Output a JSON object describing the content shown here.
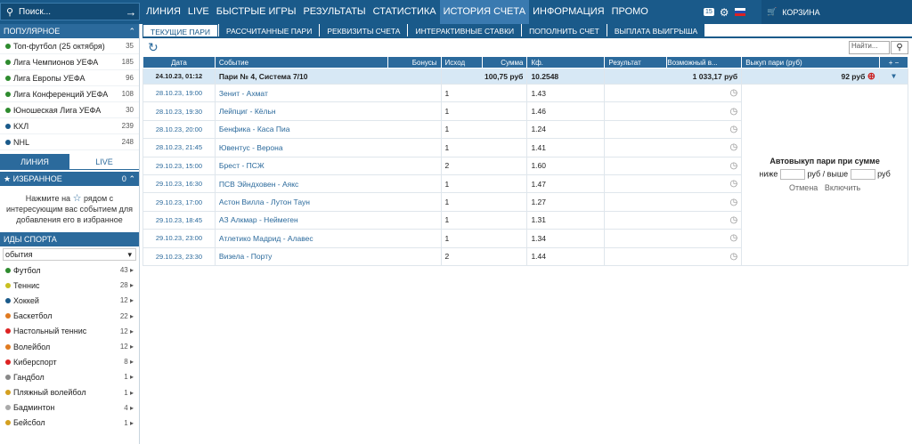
{
  "search": {
    "placeholder": "Поиск..."
  },
  "nav": [
    "ЛИНИЯ",
    "LIVE",
    "БЫСТРЫЕ ИГРЫ",
    "РЕЗУЛЬТАТЫ",
    "СТАТИСТИКА",
    "ИСТОРИЯ СЧЕТА",
    "ИНФОРМАЦИЯ",
    "ПРОМО"
  ],
  "nav_active": "ИСТОРИЯ СЧЕТА",
  "top_badge": "15",
  "cart": "КОРЗИНА",
  "sidebar": {
    "popular_title": "ПОПУЛЯРНОЕ",
    "popular": [
      {
        "label": "Топ-футбол (25 октября)",
        "count": "35"
      },
      {
        "label": "Лига Чемпионов УЕФА",
        "count": "185"
      },
      {
        "label": "Лига Европы УЕФА",
        "count": "96"
      },
      {
        "label": "Лига Конференций УЕФА",
        "count": "108"
      },
      {
        "label": "Юношеская Лига УЕФА",
        "count": "30"
      },
      {
        "label": "КХЛ",
        "count": "239"
      },
      {
        "label": "NHL",
        "count": "248"
      }
    ],
    "tab_line": "ЛИНИЯ",
    "tab_live": "LIVE",
    "fav_title": "ИЗБРАННОЕ",
    "fav_count": "0",
    "fav_text1": "Нажмите на",
    "fav_text2": "рядом с интересующим вас событием для добавления его в избранное",
    "sports_title": "ИДЫ СПОРТА",
    "select_value": "обытия",
    "sports": [
      {
        "label": "Футбол",
        "count": "43",
        "color": "#2e8b2e"
      },
      {
        "label": "Теннис",
        "count": "28",
        "color": "#c9c020"
      },
      {
        "label": "Хоккей",
        "count": "12",
        "color": "#1a5a8a"
      },
      {
        "label": "Баскетбол",
        "count": "22",
        "color": "#e07a20"
      },
      {
        "label": "Настольный теннис",
        "count": "12",
        "color": "#d22"
      },
      {
        "label": "Волейбол",
        "count": "12",
        "color": "#e07a20"
      },
      {
        "label": "Киберспорт",
        "count": "8",
        "color": "#d22"
      },
      {
        "label": "Гандбол",
        "count": "1",
        "color": "#888"
      },
      {
        "label": "Пляжный волейбол",
        "count": "1",
        "color": "#d4a020"
      },
      {
        "label": "Бадминтон",
        "count": "4",
        "color": "#aaa"
      },
      {
        "label": "Бейсбол",
        "count": "1",
        "color": "#d4a020"
      }
    ]
  },
  "tabs": [
    "ТЕКУЩИЕ ПАРИ",
    "РАССЧИТАННЫЕ ПАРИ",
    "РЕКВИЗИТЫ СЧЕТА",
    "ИНТЕРАКТИВНЫЕ СТАВКИ",
    "ПОПОЛНИТЬ СЧЕТ",
    "ВЫПЛАТА ВЫИГРЫША"
  ],
  "find_placeholder": "Найти...",
  "table": {
    "headers": {
      "date": "Дата",
      "event": "Событие",
      "bonus": "Бонусы",
      "outcome": "Исход",
      "sum": "Сумма",
      "coef": "Кф.",
      "result": "Результат",
      "possible": "Возможный в...",
      "buyout": "Выкуп пари (руб)"
    },
    "summary": {
      "date": "24.10.23, 01:12",
      "event": "Пари № 4, Система 7/10",
      "sum": "100,75 руб",
      "coef": "10.2548",
      "possible": "1 033,17 руб",
      "buyout": "92 руб"
    },
    "rows": [
      {
        "date": "28.10.23, 19:00",
        "event": "Зенит - Ахмат",
        "outcome": "1",
        "coef": "1.43"
      },
      {
        "date": "28.10.23, 19:30",
        "event": "Лейпциг - Кёльн",
        "outcome": "1",
        "coef": "1.46"
      },
      {
        "date": "28.10.23, 20:00",
        "event": "Бенфика - Каса Пиа",
        "outcome": "1",
        "coef": "1.24"
      },
      {
        "date": "28.10.23, 21:45",
        "event": "Ювентус - Верона",
        "outcome": "1",
        "coef": "1.41"
      },
      {
        "date": "29.10.23, 15:00",
        "event": "Брест - ПСЖ",
        "outcome": "2",
        "coef": "1.60"
      },
      {
        "date": "29.10.23, 16:30",
        "event": "ПСВ Эйндховен - Аякс",
        "outcome": "1",
        "coef": "1.47"
      },
      {
        "date": "29.10.23, 17:00",
        "event": "Астон Вилла - Лутон Таун",
        "outcome": "1",
        "coef": "1.27"
      },
      {
        "date": "29.10.23, 18:45",
        "event": "АЗ Алкмар - Неймеген",
        "outcome": "1",
        "coef": "1.31"
      },
      {
        "date": "29.10.23, 23:00",
        "event": "Атлетико Мадрид - Алавес",
        "outcome": "1",
        "coef": "1.34"
      },
      {
        "date": "29.10.23, 23:30",
        "event": "Визела - Порту",
        "outcome": "2",
        "coef": "1.44"
      }
    ]
  },
  "autobuy": {
    "title": "Автовыкуп пари при сумме",
    "below": "ниже",
    "rub": "руб",
    "above": "выше",
    "cancel": "Отмена",
    "enable": "Включить"
  }
}
